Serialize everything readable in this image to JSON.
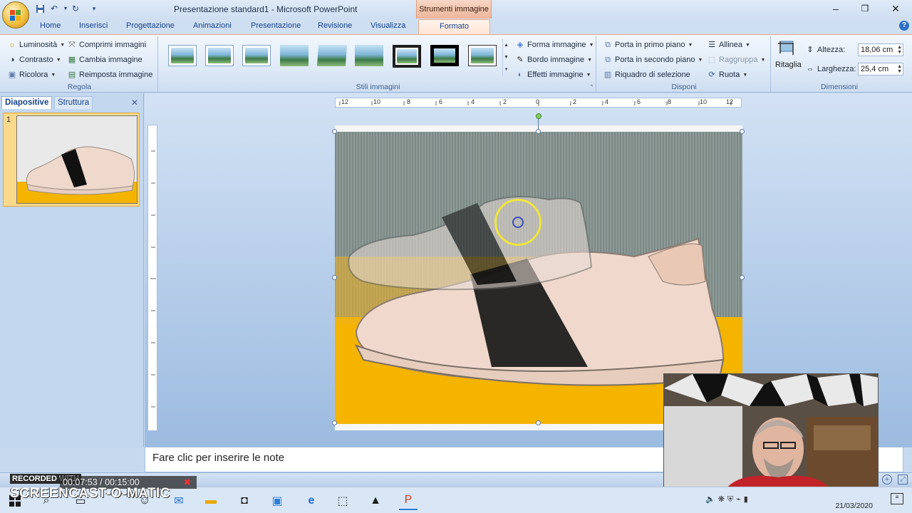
{
  "window": {
    "title": "Presentazione standard1 - Microsoft PowerPoint",
    "contextual_tab_group": "Strumenti immagine"
  },
  "tabs": [
    "Home",
    "Inserisci",
    "Progettazione",
    "Animazioni",
    "Presentazione",
    "Revisione",
    "Visualizza",
    "Formato"
  ],
  "active_tab": "Formato",
  "ribbon": {
    "regola": {
      "label": "Regola",
      "luminosita": "Luminosità",
      "contrasto": "Contrasto",
      "ricolora": "Ricolora",
      "comprimi": "Comprimi immagini",
      "cambia": "Cambia immagine",
      "reimposta": "Reimposta immagine"
    },
    "stili": {
      "label": "Stili immagini",
      "forma": "Forma immagine",
      "bordo": "Bordo immagine",
      "effetti": "Effetti immagine"
    },
    "disponi": {
      "label": "Disponi",
      "primo_piano": "Porta in primo piano",
      "secondo_piano": "Porta in secondo piano",
      "riquadro": "Riquadro di selezione",
      "allinea": "Allinea",
      "raggruppa": "Raggruppa",
      "ruota": "Ruota"
    },
    "dimensioni": {
      "label": "Dimensioni",
      "ritaglia": "Ritaglia",
      "altezza_label": "Altezza:",
      "altezza_value": "18,06 cm",
      "larghezza_label": "Larghezza:",
      "larghezza_value": "25,4 cm"
    }
  },
  "left_pane": {
    "tab_diapositive": "Diapositive",
    "tab_struttura": "Struttura",
    "slide_number": "1"
  },
  "ruler": {
    "horizontal": [
      "12",
      "10",
      "8",
      "6",
      "4",
      "2",
      "0",
      "2",
      "4",
      "6",
      "8",
      "10",
      "12"
    ]
  },
  "notes": {
    "placeholder": "Fare clic per inserire le note"
  },
  "overlay": {
    "recorded_with": "RECORDED WITH",
    "timer": "00:07:53 / 00:15:00",
    "brand": "SCREENCAST-O-MATIC"
  },
  "taskbar": {
    "date": "21/03/2020"
  },
  "colors": {
    "accent": "#15428b",
    "contextual": "#eeb59a",
    "selection": "#fbd98b"
  }
}
